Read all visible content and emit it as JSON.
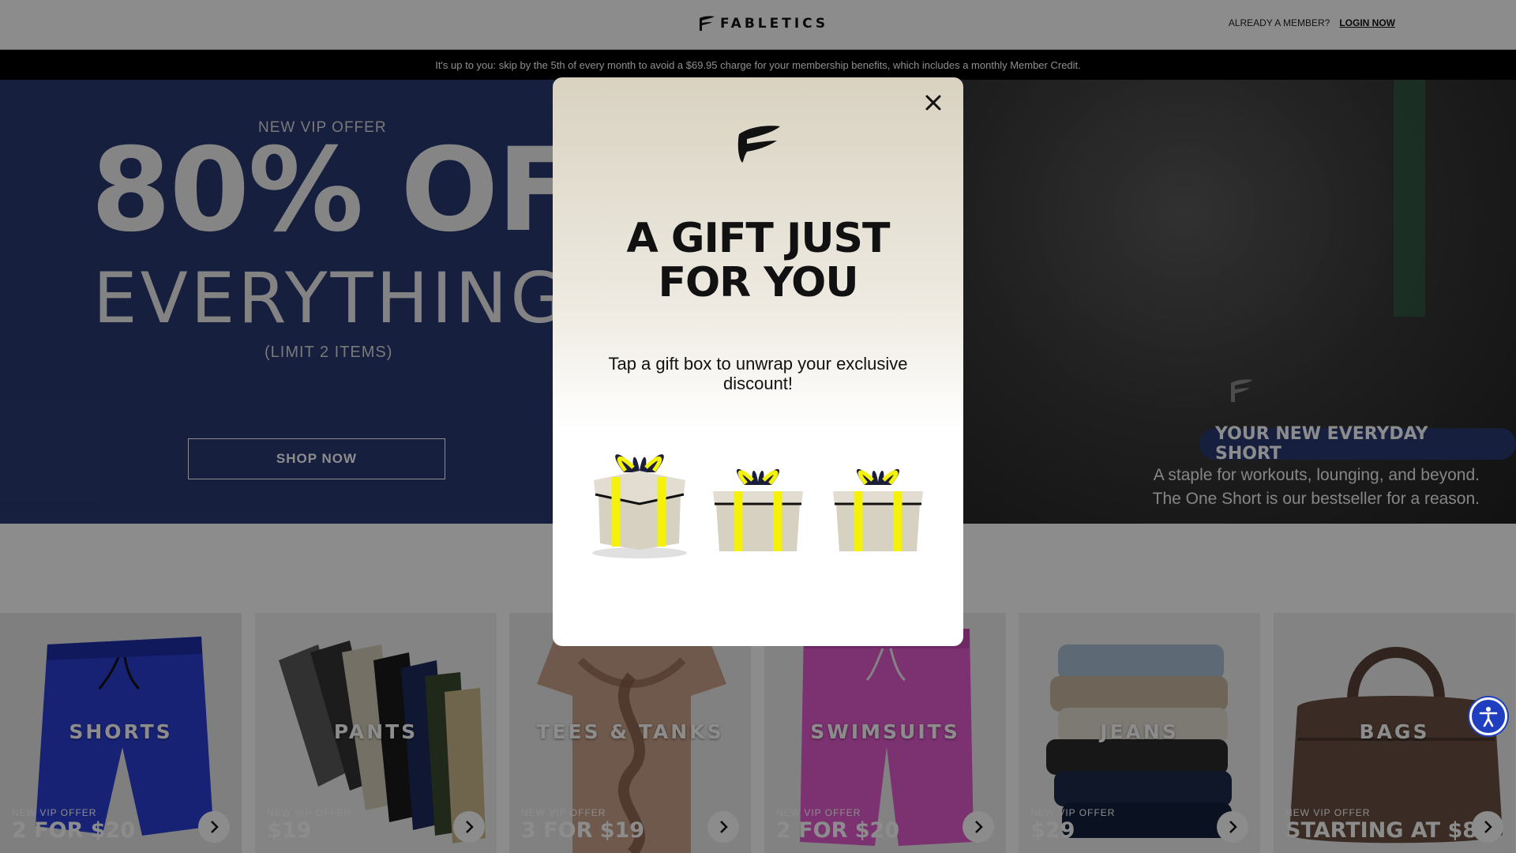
{
  "header": {
    "brand": "FABLETICS",
    "member_question": "ALREADY A MEMBER?",
    "login_label": "LOGIN NOW"
  },
  "banner": {
    "text": "It's up to you: skip by the 5th of every month to avoid a $69.95 charge for your membership benefits, which includes a monthly Member Credit."
  },
  "hero": {
    "vip_label": "NEW VIP OFFER",
    "headline": "80% OFF",
    "subheadline": "EVERYTHING",
    "limit": "(LIMIT 2 ITEMS)",
    "cta_label": "SHOP NOW",
    "tag": "YOUR NEW EVERYDAY SHORT",
    "description_line1": "A staple for workouts, lounging, and beyond.",
    "description_line2": "The One Short is our bestseller for a reason."
  },
  "categories": [
    {
      "name": "SHORTS",
      "offer_label": "NEW VIP OFFER",
      "price": "2 FOR $20"
    },
    {
      "name": "PANTS",
      "offer_label": "NEW VIP OFFER",
      "price": "$19"
    },
    {
      "name": "TEES & TANKS",
      "offer_label": "NEW VIP OFFER",
      "price": "3 FOR $19"
    },
    {
      "name": "SWIMSUITS",
      "offer_label": "NEW VIP OFFER",
      "price": "2 FOR $20"
    },
    {
      "name": "JEANS",
      "offer_label": "NEW VIP OFFER",
      "price": "$29"
    },
    {
      "name": "BAGS",
      "offer_label": "NEW VIP OFFER",
      "price": "STARTING AT $8"
    }
  ],
  "modal": {
    "title_line1": "A GIFT JUST",
    "title_line2": "FOR YOU",
    "subtitle": "Tap a gift box to unwrap your exclusive discount!",
    "gift_count": 3
  },
  "icons": {
    "close": "close-icon",
    "arrow": "chevron-right-icon",
    "accessibility": "accessibility-icon",
    "brand": "fabletics-logo-icon"
  },
  "colors": {
    "hero_navy": "#2a3a73",
    "gift_ribbon": "#f5f20a",
    "gift_box": "#d7d1c2",
    "accessibility_blue": "#1f3fc0"
  }
}
